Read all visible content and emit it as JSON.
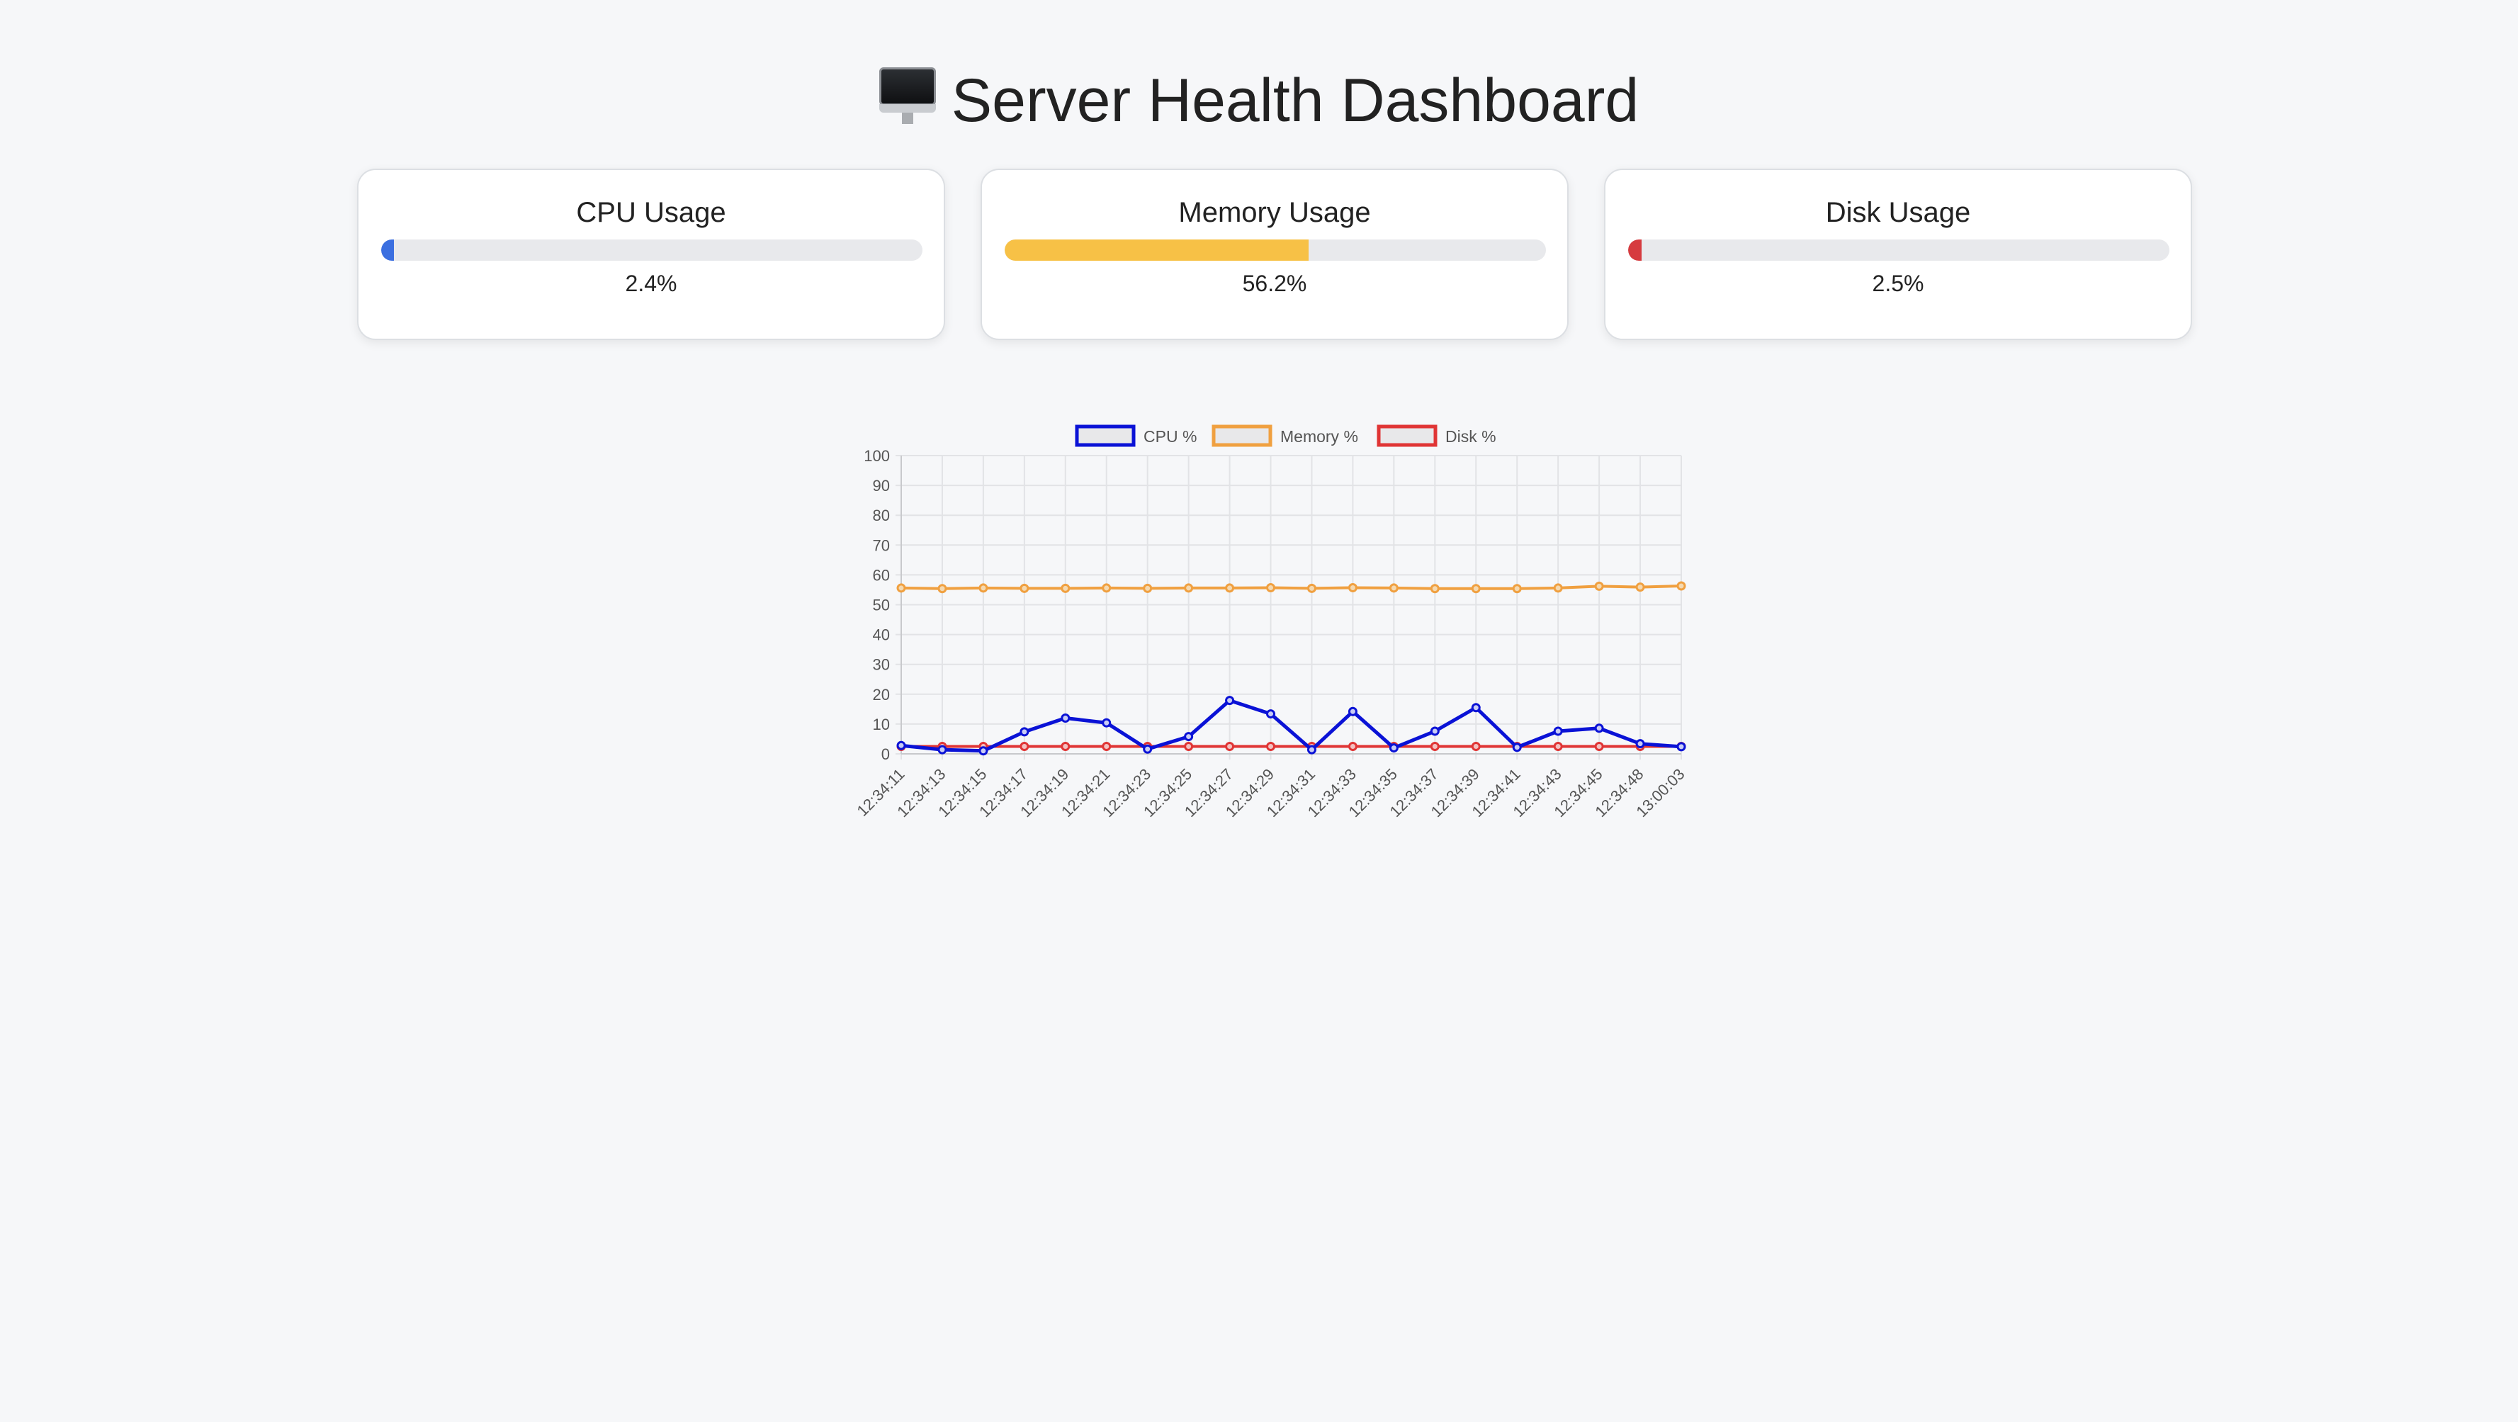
{
  "header": {
    "title": "Server Health Dashboard",
    "icon": "desktop-computer-icon"
  },
  "cards": [
    {
      "title": "CPU Usage",
      "value": 2.4,
      "value_text": "2.4%",
      "color": "#3b6fe0"
    },
    {
      "title": "Memory Usage",
      "value": 56.2,
      "value_text": "56.2%",
      "color": "#f7c146"
    },
    {
      "title": "Disk Usage",
      "value": 2.5,
      "value_text": "2.5%",
      "color": "#d63b3f"
    }
  ],
  "chart_data": {
    "type": "line",
    "title": "",
    "xlabel": "",
    "ylabel": "",
    "ylim": [
      0,
      100
    ],
    "yticks": [
      0,
      10,
      20,
      30,
      40,
      50,
      60,
      70,
      80,
      90,
      100
    ],
    "grid": true,
    "legend_position": "top-center",
    "categories": [
      "12:34:11",
      "12:34:13",
      "12:34:15",
      "12:34:17",
      "12:34:19",
      "12:34:21",
      "12:34:23",
      "12:34:25",
      "12:34:27",
      "12:34:29",
      "12:34:31",
      "12:34:33",
      "12:34:35",
      "12:34:37",
      "12:34:39",
      "12:34:41",
      "12:34:43",
      "12:34:45",
      "12:34:48",
      "13:00:03"
    ],
    "series": [
      {
        "name": "CPU %",
        "color": "#0a12d6",
        "values": [
          2.8,
          1.4,
          1.0,
          7.4,
          12.0,
          10.4,
          1.6,
          5.8,
          17.9,
          13.4,
          1.4,
          14.2,
          2.0,
          7.6,
          15.5,
          2.2,
          7.6,
          8.6,
          3.4,
          2.4
        ]
      },
      {
        "name": "Memory %",
        "color": "#f0a040",
        "values": [
          55.6,
          55.4,
          55.6,
          55.5,
          55.5,
          55.6,
          55.5,
          55.6,
          55.6,
          55.7,
          55.5,
          55.7,
          55.6,
          55.4,
          55.4,
          55.4,
          55.6,
          56.2,
          55.9,
          56.3
        ]
      },
      {
        "name": "Disk %",
        "color": "#e03535",
        "values": [
          2.5,
          2.5,
          2.5,
          2.5,
          2.5,
          2.5,
          2.5,
          2.5,
          2.5,
          2.5,
          2.5,
          2.5,
          2.5,
          2.5,
          2.5,
          2.5,
          2.5,
          2.5,
          2.5,
          2.5
        ]
      }
    ]
  }
}
